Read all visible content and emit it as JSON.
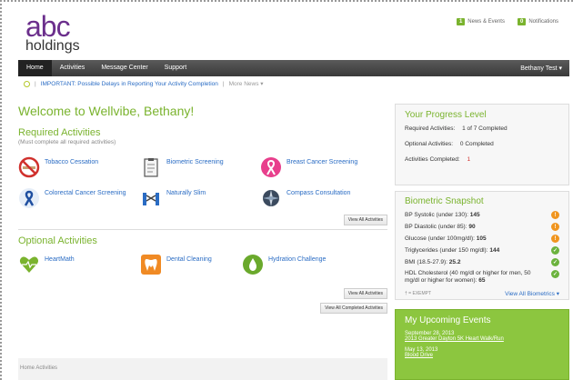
{
  "header": {
    "logo_top": "abc",
    "logo_bottom": "holdings"
  },
  "top_links": [
    {
      "count": "1",
      "label": "News & Events"
    },
    {
      "count": "0",
      "label": "Notifications"
    }
  ],
  "nav": {
    "items": [
      "Home",
      "Activities",
      "Message Center",
      "Support"
    ],
    "user": "Bethany Test ▾"
  },
  "ticker": {
    "sep": "|",
    "headline": "IMPORTANT: Possible Delays in Reporting Your Activity Completion",
    "more": "More News ▾"
  },
  "main": {
    "welcome": "Welcome to Wellvibe, Bethany!",
    "required_title": "Required Activities",
    "required_sub": "(Must complete all required activities)",
    "required": [
      {
        "label": "Tobacco Cessation",
        "icon": "no-smoking-icon"
      },
      {
        "label": "Biometric Screening",
        "icon": "clipboard-icon"
      },
      {
        "label": "Breast Cancer Screening",
        "icon": "pink-ribbon-icon"
      },
      {
        "label": "Colorectal Cancer Screening",
        "icon": "blue-ribbon-icon"
      },
      {
        "label": "Naturally Slim",
        "icon": "measuring-tape-icon"
      },
      {
        "label": "Compass Consultation",
        "icon": "compass-icon"
      }
    ],
    "view_all_activities": "View All Activities",
    "optional_title": "Optional Activities",
    "optional": [
      {
        "label": "HeartMath",
        "icon": "heart-icon"
      },
      {
        "label": "Dental Cleaning",
        "icon": "tooth-icon"
      },
      {
        "label": "Hydration Challenge",
        "icon": "water-drop-icon"
      }
    ],
    "view_all_activities_2": "View All Activities",
    "view_all_completed": "View All Completed Activities"
  },
  "breadcrumb": {
    "home": "Home",
    "current": "Activities"
  },
  "progress": {
    "title": "Your Progress Level",
    "required_label": "Required Activities:",
    "required_value": "1 of 7 Completed",
    "optional_label": "Optional Activities:",
    "optional_value": "0 Completed",
    "completed_label": "Activities Completed:",
    "completed_value": "1"
  },
  "biometric": {
    "title": "Biometric Snapshot",
    "rows": [
      {
        "label": "BP Systolic (under 130):",
        "value": "145",
        "status": "warn"
      },
      {
        "label": "BP Diastolic (under 85):",
        "value": "90",
        "status": "warn"
      },
      {
        "label": "Glucose (under 100mg/dl):",
        "value": "105",
        "status": "warn"
      },
      {
        "label": "Triglycerides (under 150 mg/dl):",
        "value": "144",
        "status": "ok"
      },
      {
        "label": "BMI (18.5-27.9):",
        "value": "25.2",
        "status": "ok"
      },
      {
        "label": "HDL Cholesterol (40 mg/dl or higher for men, 50 mg/dl or higher for women):",
        "value": "65",
        "status": "ok"
      }
    ],
    "exempt": "† = EXEMPT",
    "view_all": "View All Biometrics ▾"
  },
  "events": {
    "title": "My Upcoming Events",
    "items": [
      {
        "date": "September 28, 2013",
        "name": "2013 Greater Dayton 5K Heart Walk/Run"
      },
      {
        "date": "May 13, 2013",
        "name": "Blood Drive"
      }
    ]
  }
}
